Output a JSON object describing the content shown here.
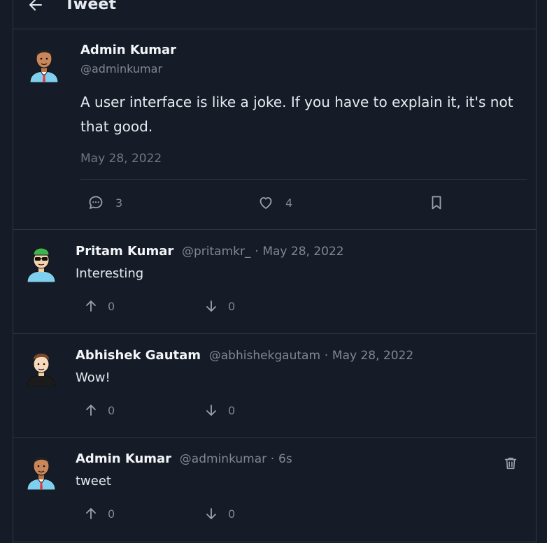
{
  "header": {
    "title": "Tweet"
  },
  "main_tweet": {
    "author_name": "Admin Kumar",
    "author_handle": "@adminkumar",
    "text": "A user interface is like a joke. If you have to explain it, it's not that good.",
    "date": "May 28, 2022",
    "reply_count": "3",
    "like_count": "4"
  },
  "replies": [
    {
      "name": "Pritam Kumar",
      "handle": "@pritamkr_",
      "separator": "·",
      "time": "May 28, 2022",
      "text": "Interesting",
      "upvotes": "0",
      "downvotes": "0"
    },
    {
      "name": "Abhishek Gautam",
      "handle": "@abhishekgautam",
      "separator": "·",
      "time": "May 28, 2022",
      "text": "Wow!",
      "upvotes": "0",
      "downvotes": "0"
    },
    {
      "name": "Admin Kumar",
      "handle": "@adminkumar",
      "separator": "·",
      "time": "6s",
      "text": "tweet",
      "upvotes": "0",
      "downvotes": "0"
    }
  ],
  "colors": {
    "background": "#151c28",
    "border": "#2f3740",
    "muted_text": "#7e8893",
    "primary_text": "#e7ebef"
  },
  "icons": {
    "back": "arrow-left-icon",
    "reply": "comment-icon",
    "like": "heart-icon",
    "bookmark": "bookmark-icon",
    "upvote": "arrow-up-icon",
    "downvote": "arrow-down-icon",
    "delete": "trash-icon"
  }
}
